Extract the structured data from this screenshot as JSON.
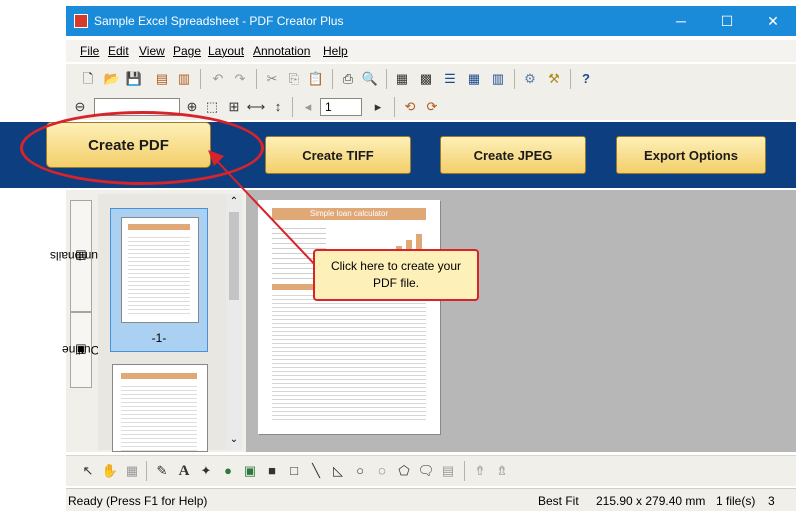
{
  "window": {
    "title": "Sample Excel Spreadsheet - PDF Creator Plus",
    "minimize": "─",
    "maximize": "☐",
    "close": "✕"
  },
  "menu": [
    "File",
    "Edit",
    "View",
    "Page",
    "Layout",
    "Annotation",
    "Help"
  ],
  "toolbar2": {
    "page_field": "1"
  },
  "ribbon": {
    "create_pdf": "Create PDF",
    "create_tiff": "Create TIFF",
    "create_jpeg": "Create JPEG",
    "export_options": "Export Options"
  },
  "side_panel": {
    "tab_thumbnails": "Thumbnails",
    "tab_outline": "Outline",
    "thumb_label": "-1-"
  },
  "page_preview": {
    "heading": "Simple loan calculator"
  },
  "callout": {
    "line1": "Click here to create your",
    "line2": "PDF file."
  },
  "status": {
    "left": "Ready (Press F1 for Help)",
    "fit": "Best Fit",
    "size": "215.90 x 279.40 mm",
    "files": "1 file(s)",
    "page": "3"
  },
  "colors": {
    "titlebar": "#1a8bd8",
    "ribbon": "#0d3e80",
    "button": "#f3cf6a",
    "highlight": "#d8232a",
    "sheet_header": "#e0a777"
  }
}
